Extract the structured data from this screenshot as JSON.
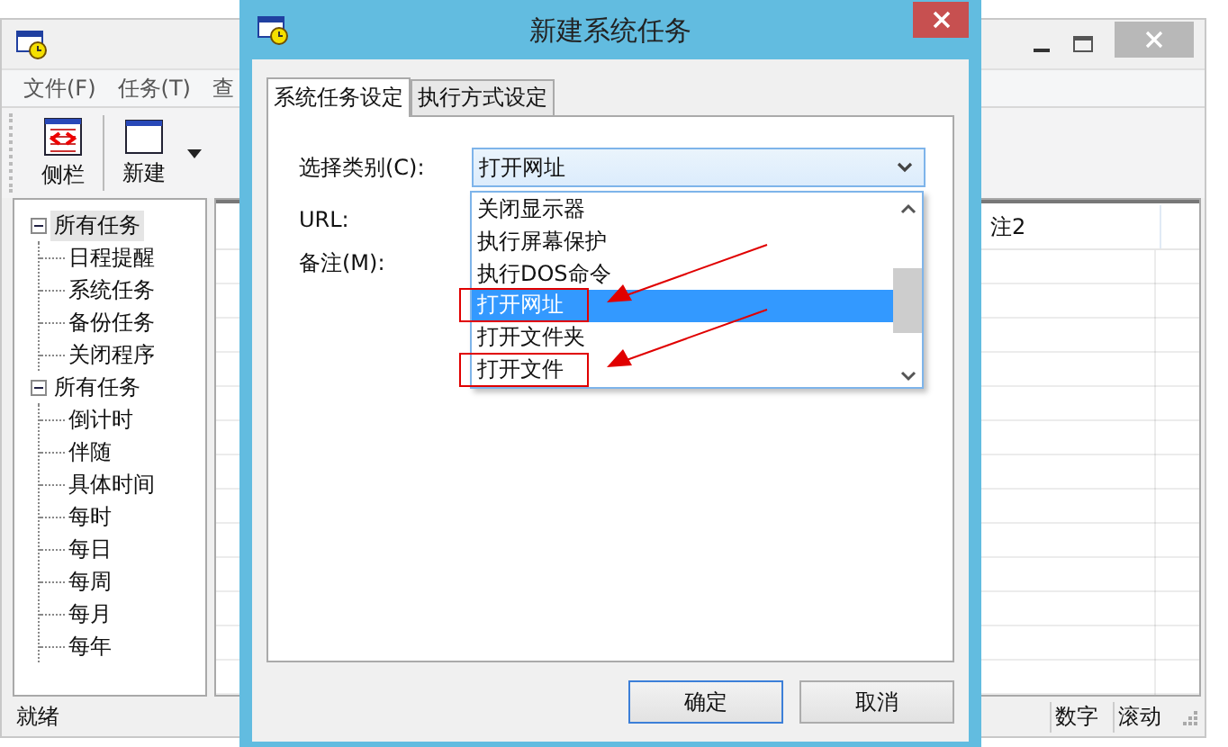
{
  "main_window": {
    "menu": [
      "文件(F)",
      "任务(T)",
      "查"
    ],
    "toolbar": [
      {
        "kind": "sidebar",
        "label": "侧栏"
      },
      {
        "kind": "new",
        "label": "新建"
      }
    ],
    "tree": [
      {
        "label": "所有任务",
        "expanded": true,
        "selected": true,
        "children": [
          {
            "label": "日程提醒"
          },
          {
            "label": "系统任务"
          },
          {
            "label": "备份任务"
          },
          {
            "label": "关闭程序"
          }
        ]
      },
      {
        "label": "所有任务",
        "expanded": true,
        "selected": false,
        "children": [
          {
            "label": "倒计时"
          },
          {
            "label": "伴随"
          },
          {
            "label": "具体时间"
          },
          {
            "label": "每时"
          },
          {
            "label": "每日"
          },
          {
            "label": "每周"
          },
          {
            "label": "每月"
          },
          {
            "label": "每年"
          }
        ]
      }
    ],
    "table": {
      "columns": [
        "注2"
      ]
    },
    "status_bar": [
      "就绪",
      "数字",
      "滚动"
    ]
  },
  "dialog": {
    "title": "新建系统任务",
    "tabs": [
      {
        "label": "系统任务设定",
        "selected": true
      },
      {
        "label": "执行方式设定",
        "selected": false
      }
    ],
    "fields": [
      {
        "kind": "combo",
        "label": "选择类别(C):",
        "value": "打开网址"
      },
      {
        "kind": "label",
        "label": "URL:"
      },
      {
        "kind": "label",
        "label": "备注(M):"
      }
    ],
    "dropdown": {
      "options": [
        {
          "label": "关闭显示器",
          "selected": false,
          "annotated": false
        },
        {
          "label": "执行屏幕保护",
          "selected": false,
          "annotated": false
        },
        {
          "label": "执行DOS命令",
          "selected": false,
          "annotated": false
        },
        {
          "label": "打开网址",
          "selected": true,
          "annotated": true
        },
        {
          "label": "打开文件夹",
          "selected": false,
          "annotated": false
        },
        {
          "label": "打开文件",
          "selected": false,
          "annotated": true
        }
      ]
    },
    "buttons": [
      {
        "label": "确定",
        "default": true
      },
      {
        "label": "取消",
        "default": false
      }
    ]
  }
}
